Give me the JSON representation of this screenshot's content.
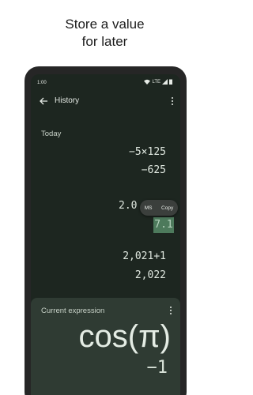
{
  "headline": {
    "line1": "Store a value",
    "line2": "for later"
  },
  "status_bar": {
    "time": "1:00",
    "network": "LTE"
  },
  "app_bar": {
    "title": "History",
    "back_icon": "arrow-back-icon",
    "menu_icon": "more-vert-icon"
  },
  "history": {
    "section_label": "Today",
    "entries": [
      {
        "expression": "−5×125",
        "result": "−625"
      },
      {
        "expression": "2.0",
        "result": "7.1"
      },
      {
        "expression": "2,021+1",
        "result": "2,022"
      }
    ]
  },
  "context_menu": {
    "items": [
      "MS",
      "Copy"
    ]
  },
  "current": {
    "label": "Current expression",
    "expression": "cos(π)",
    "result": "−1"
  },
  "colors": {
    "background": "#ffffff",
    "screen": "#1d2620",
    "current_panel": "#2f3b33",
    "highlight": "#4d7a5c"
  }
}
